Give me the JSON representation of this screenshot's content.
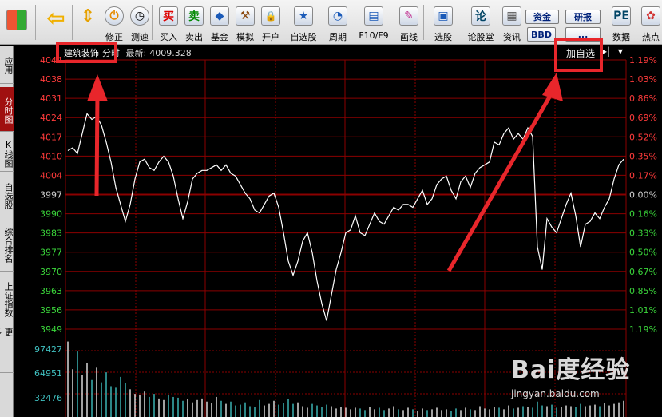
{
  "toolbar": {
    "buttons": [
      {
        "label": "",
        "icon": "app-grid-icon"
      },
      {
        "label": "",
        "icon": "back-arrow-icon"
      },
      {
        "label": "",
        "icon": "updown-arrow-icon"
      },
      {
        "label": "修正",
        "icon": "power-icon"
      },
      {
        "label": "测速",
        "icon": "clock-icon"
      },
      {
        "label": "买入",
        "icon": "buy-icon",
        "glyph": "买"
      },
      {
        "label": "卖出",
        "icon": "sell-icon",
        "glyph": "卖"
      },
      {
        "label": "基金",
        "icon": "fund-icon"
      },
      {
        "label": "模拟",
        "icon": "gavel-icon"
      },
      {
        "label": "开户",
        "icon": "lock-icon"
      },
      {
        "label": "自选股",
        "icon": "star-list-icon"
      },
      {
        "label": "周期",
        "icon": "cycle-clock-icon"
      },
      {
        "label": "F10/F9",
        "icon": "f10-icon"
      },
      {
        "label": "画线",
        "icon": "pencil-icon"
      },
      {
        "label": "选股",
        "icon": "screen-icon"
      },
      {
        "label": "论股堂",
        "icon": "lun-icon",
        "glyph": "论"
      },
      {
        "label": "资讯",
        "icon": "news-icon"
      },
      {
        "label": "数据",
        "icon": "pe-icon",
        "glyph": "PE"
      },
      {
        "label": "热点",
        "icon": "hot-icon"
      }
    ],
    "small_buttons": {
      "zijin": "资金",
      "bbd": "BBD",
      "yanbao": "研报",
      "other": "..."
    }
  },
  "sidebar": {
    "tabs": [
      "应用",
      "分时图",
      "K线图",
      "自选股",
      "综合排名",
      "上证指数",
      "更多..."
    ]
  },
  "infobar": {
    "name": "建筑装饰",
    "mode": "分时",
    "latest_label": "最新:",
    "latest_value": "4009.328",
    "add_fav": "加自选"
  },
  "chart_data": {
    "type": "line",
    "prev_close": 3997,
    "y_ticks": [
      "4044",
      "4038",
      "4031",
      "4024",
      "4017",
      "4010",
      "4004",
      "3997",
      "3990",
      "3983",
      "3977",
      "3970",
      "3963",
      "3956",
      "3949"
    ],
    "pct_ticks": [
      "1.19%",
      "1.03%",
      "0.86%",
      "0.69%",
      "0.52%",
      "0.35%",
      "0.17%",
      "0.00%",
      "0.16%",
      "0.33%",
      "0.50%",
      "0.67%",
      "0.85%",
      "1.01%",
      "1.19%"
    ],
    "volume_ticks": [
      "97427",
      "64951",
      "32476"
    ],
    "price": [
      4012,
      4013,
      4011,
      4018,
      4025,
      4023,
      4024,
      4021,
      4015,
      4008,
      3999,
      3993,
      3987,
      3993,
      4002,
      4008,
      4009,
      4006,
      4005,
      4008,
      4010,
      4008,
      4003,
      3995,
      3988,
      3994,
      4002,
      4004,
      4005,
      4005,
      4006,
      4007,
      4005,
      4007,
      4004,
      4003,
      4000,
      3997,
      3995,
      3991,
      3990,
      3993,
      3996,
      3997,
      3992,
      3983,
      3973,
      3968,
      3973,
      3980,
      3983,
      3976,
      3966,
      3958,
      3952,
      3961,
      3970,
      3976,
      3983,
      3984,
      3989,
      3983,
      3982,
      3986,
      3990,
      3987,
      3986,
      3989,
      3992,
      3991,
      3993,
      3993,
      3992,
      3995,
      3998,
      3993,
      3995,
      4000,
      4002,
      4003,
      3998,
      3995,
      4001,
      4003,
      3999,
      4004,
      4006,
      4007,
      4008,
      4015,
      4014,
      4018,
      4020,
      4016,
      4018,
      4016,
      4020,
      4017,
      3978,
      3970,
      3988,
      3985,
      3983,
      3988,
      3993,
      3997,
      3989,
      3978,
      3986,
      3987,
      3990,
      3988,
      3992,
      3995,
      4002,
      4007,
      4009
    ],
    "volume": [
      98000,
      62000,
      85000,
      55000,
      70000,
      48000,
      64000,
      45000,
      58000,
      40000,
      38000,
      52000,
      44000,
      36000,
      30000,
      28000,
      33000,
      26000,
      30000,
      24000,
      22000,
      28000,
      26000,
      25000,
      21000,
      23000,
      19000,
      22000,
      24000,
      20000,
      18000,
      26000,
      21000,
      17000,
      20000,
      15000,
      16000,
      19000,
      14000,
      13000,
      22000,
      15000,
      17000,
      21000,
      16000,
      18000,
      23000,
      17000,
      19000,
      14000,
      12000,
      17000,
      15000,
      13000,
      16000,
      14000,
      11000,
      13000,
      12000,
      10000,
      12000,
      11000,
      9000,
      13000,
      10000,
      12000,
      9000,
      11000,
      14000,
      10000,
      9000,
      12000,
      10000,
      8000,
      11000,
      9000,
      10000,
      12000,
      9000,
      10000,
      8000,
      11000,
      9000,
      12000,
      10000,
      9000,
      14000,
      11000,
      10000,
      13000,
      12000,
      10000,
      15000,
      11000,
      12000,
      14000,
      13000,
      12000,
      20000,
      15000,
      14000,
      16000,
      12000,
      13000,
      15000,
      14000,
      13000,
      17000,
      14000,
      15000,
      16000,
      14000,
      18000,
      15000,
      17000,
      19000,
      21000
    ]
  },
  "watermark": {
    "brand": "Bai度经验",
    "url": "jingyan.baidu.com"
  },
  "colors": {
    "up": "#ff3b3b",
    "down": "#3bd63b",
    "grid": "#8b0000",
    "line": "#ffffff"
  }
}
